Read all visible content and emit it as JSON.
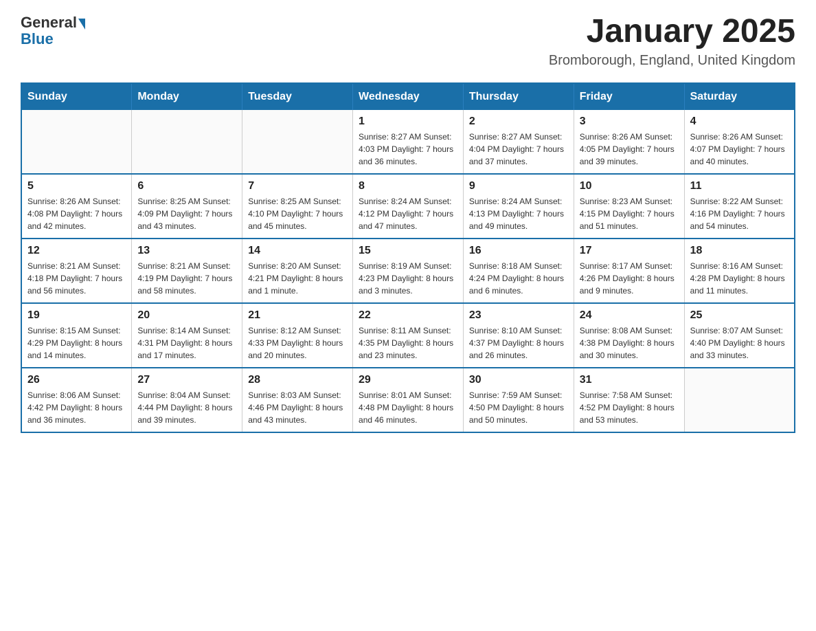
{
  "header": {
    "logo": {
      "general_text": "General",
      "blue_text": "Blue"
    },
    "title": "January 2025",
    "subtitle": "Bromborough, England, United Kingdom"
  },
  "calendar": {
    "days_of_week": [
      "Sunday",
      "Monday",
      "Tuesday",
      "Wednesday",
      "Thursday",
      "Friday",
      "Saturday"
    ],
    "weeks": [
      [
        {
          "day": "",
          "info": ""
        },
        {
          "day": "",
          "info": ""
        },
        {
          "day": "",
          "info": ""
        },
        {
          "day": "1",
          "info": "Sunrise: 8:27 AM\nSunset: 4:03 PM\nDaylight: 7 hours\nand 36 minutes."
        },
        {
          "day": "2",
          "info": "Sunrise: 8:27 AM\nSunset: 4:04 PM\nDaylight: 7 hours\nand 37 minutes."
        },
        {
          "day": "3",
          "info": "Sunrise: 8:26 AM\nSunset: 4:05 PM\nDaylight: 7 hours\nand 39 minutes."
        },
        {
          "day": "4",
          "info": "Sunrise: 8:26 AM\nSunset: 4:07 PM\nDaylight: 7 hours\nand 40 minutes."
        }
      ],
      [
        {
          "day": "5",
          "info": "Sunrise: 8:26 AM\nSunset: 4:08 PM\nDaylight: 7 hours\nand 42 minutes."
        },
        {
          "day": "6",
          "info": "Sunrise: 8:25 AM\nSunset: 4:09 PM\nDaylight: 7 hours\nand 43 minutes."
        },
        {
          "day": "7",
          "info": "Sunrise: 8:25 AM\nSunset: 4:10 PM\nDaylight: 7 hours\nand 45 minutes."
        },
        {
          "day": "8",
          "info": "Sunrise: 8:24 AM\nSunset: 4:12 PM\nDaylight: 7 hours\nand 47 minutes."
        },
        {
          "day": "9",
          "info": "Sunrise: 8:24 AM\nSunset: 4:13 PM\nDaylight: 7 hours\nand 49 minutes."
        },
        {
          "day": "10",
          "info": "Sunrise: 8:23 AM\nSunset: 4:15 PM\nDaylight: 7 hours\nand 51 minutes."
        },
        {
          "day": "11",
          "info": "Sunrise: 8:22 AM\nSunset: 4:16 PM\nDaylight: 7 hours\nand 54 minutes."
        }
      ],
      [
        {
          "day": "12",
          "info": "Sunrise: 8:21 AM\nSunset: 4:18 PM\nDaylight: 7 hours\nand 56 minutes."
        },
        {
          "day": "13",
          "info": "Sunrise: 8:21 AM\nSunset: 4:19 PM\nDaylight: 7 hours\nand 58 minutes."
        },
        {
          "day": "14",
          "info": "Sunrise: 8:20 AM\nSunset: 4:21 PM\nDaylight: 8 hours\nand 1 minute."
        },
        {
          "day": "15",
          "info": "Sunrise: 8:19 AM\nSunset: 4:23 PM\nDaylight: 8 hours\nand 3 minutes."
        },
        {
          "day": "16",
          "info": "Sunrise: 8:18 AM\nSunset: 4:24 PM\nDaylight: 8 hours\nand 6 minutes."
        },
        {
          "day": "17",
          "info": "Sunrise: 8:17 AM\nSunset: 4:26 PM\nDaylight: 8 hours\nand 9 minutes."
        },
        {
          "day": "18",
          "info": "Sunrise: 8:16 AM\nSunset: 4:28 PM\nDaylight: 8 hours\nand 11 minutes."
        }
      ],
      [
        {
          "day": "19",
          "info": "Sunrise: 8:15 AM\nSunset: 4:29 PM\nDaylight: 8 hours\nand 14 minutes."
        },
        {
          "day": "20",
          "info": "Sunrise: 8:14 AM\nSunset: 4:31 PM\nDaylight: 8 hours\nand 17 minutes."
        },
        {
          "day": "21",
          "info": "Sunrise: 8:12 AM\nSunset: 4:33 PM\nDaylight: 8 hours\nand 20 minutes."
        },
        {
          "day": "22",
          "info": "Sunrise: 8:11 AM\nSunset: 4:35 PM\nDaylight: 8 hours\nand 23 minutes."
        },
        {
          "day": "23",
          "info": "Sunrise: 8:10 AM\nSunset: 4:37 PM\nDaylight: 8 hours\nand 26 minutes."
        },
        {
          "day": "24",
          "info": "Sunrise: 8:08 AM\nSunset: 4:38 PM\nDaylight: 8 hours\nand 30 minutes."
        },
        {
          "day": "25",
          "info": "Sunrise: 8:07 AM\nSunset: 4:40 PM\nDaylight: 8 hours\nand 33 minutes."
        }
      ],
      [
        {
          "day": "26",
          "info": "Sunrise: 8:06 AM\nSunset: 4:42 PM\nDaylight: 8 hours\nand 36 minutes."
        },
        {
          "day": "27",
          "info": "Sunrise: 8:04 AM\nSunset: 4:44 PM\nDaylight: 8 hours\nand 39 minutes."
        },
        {
          "day": "28",
          "info": "Sunrise: 8:03 AM\nSunset: 4:46 PM\nDaylight: 8 hours\nand 43 minutes."
        },
        {
          "day": "29",
          "info": "Sunrise: 8:01 AM\nSunset: 4:48 PM\nDaylight: 8 hours\nand 46 minutes."
        },
        {
          "day": "30",
          "info": "Sunrise: 7:59 AM\nSunset: 4:50 PM\nDaylight: 8 hours\nand 50 minutes."
        },
        {
          "day": "31",
          "info": "Sunrise: 7:58 AM\nSunset: 4:52 PM\nDaylight: 8 hours\nand 53 minutes."
        },
        {
          "day": "",
          "info": ""
        }
      ]
    ]
  }
}
